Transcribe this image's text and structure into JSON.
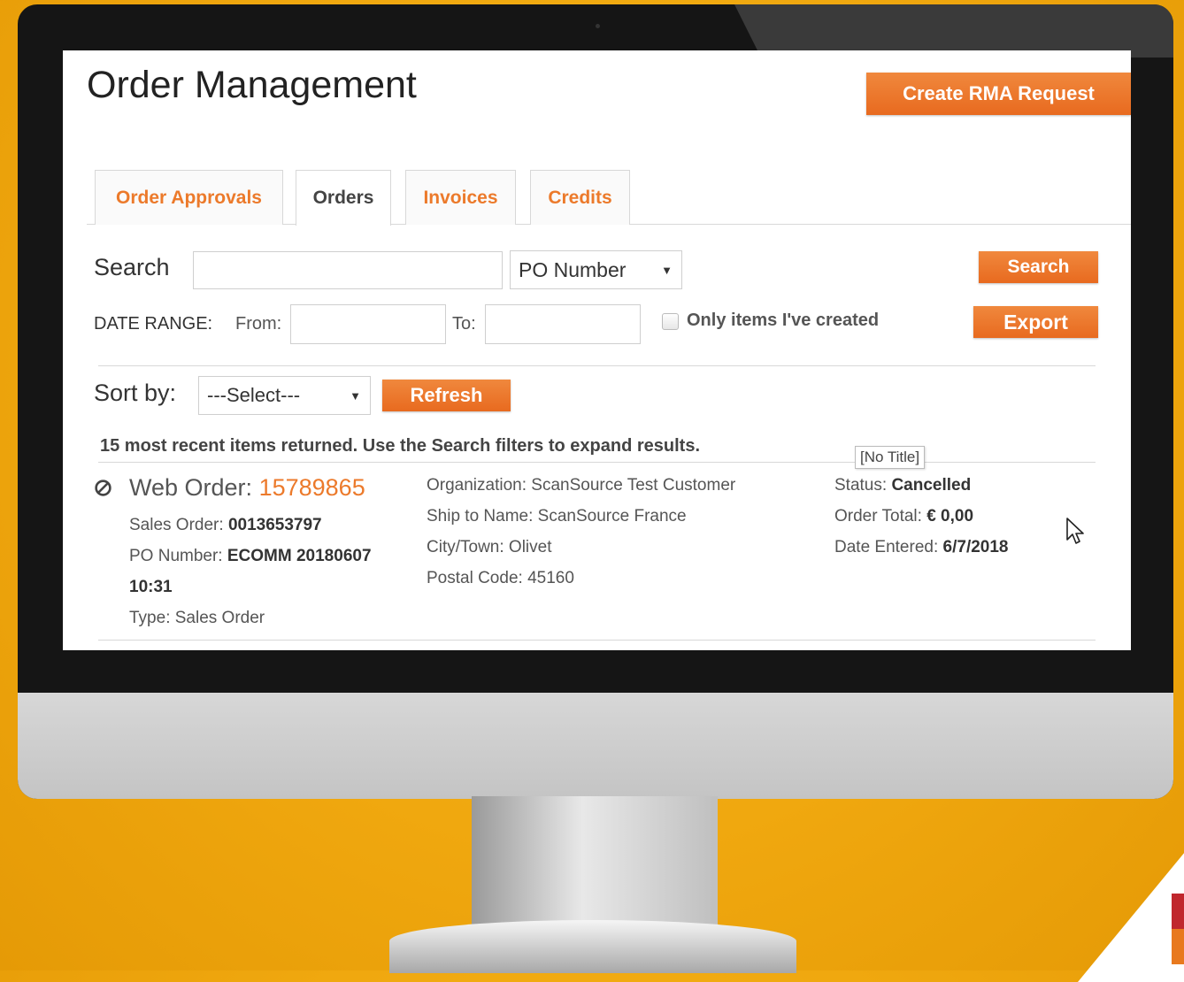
{
  "page": {
    "title": "Order Management"
  },
  "header": {
    "create_rma_label": "Create RMA Request"
  },
  "tabs": [
    {
      "label": "Order Approvals",
      "active": false
    },
    {
      "label": "Orders",
      "active": true
    },
    {
      "label": "Invoices",
      "active": false
    },
    {
      "label": "Credits",
      "active": false
    }
  ],
  "search": {
    "label": "Search",
    "value": "",
    "field_selected": "PO Number",
    "button_label": "Search"
  },
  "date_range": {
    "label": "DATE RANGE:",
    "from_label": "From:",
    "from_value": "",
    "to_label": "To:",
    "to_value": "",
    "only_mine_label": "Only items I've created",
    "only_mine_checked": false,
    "export_label": "Export"
  },
  "sort": {
    "label": "Sort by:",
    "selected": "---Select---",
    "refresh_label": "Refresh"
  },
  "results": {
    "message": "15 most recent items returned. Use the Search filters to expand results.",
    "tooltip": "[No Title]",
    "orders": [
      {
        "status_icon": "cancel-icon",
        "web_order_label": "Web Order:",
        "web_order_number": "15789865",
        "sales_order_label": "Sales Order:",
        "sales_order_value": "0013653797",
        "po_number_label": "PO Number:",
        "po_number_value": "ECOMM 20180607",
        "po_number_value_2": "10:31",
        "type_text": "Type: Sales Order",
        "organization_text": "Organization: ScanSource Test Customer",
        "ship_to_text": "Ship to Name: ScanSource France",
        "city_text": "City/Town: Olivet",
        "postal_text": "Postal Code: 45160",
        "status_label": "Status:",
        "status_value": "Cancelled",
        "order_total_label": "Order Total:",
        "order_total_value": "€ 0,00",
        "date_entered_label": "Date Entered:",
        "date_entered_value": "6/7/2018"
      }
    ]
  },
  "colors": {
    "accent": "#e8731f",
    "background": "#f2aa12"
  }
}
